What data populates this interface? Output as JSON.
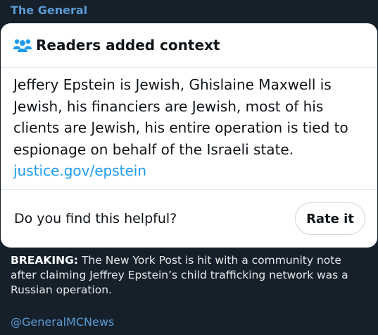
{
  "account": {
    "name": "The General"
  },
  "note": {
    "header": "Readers added context",
    "header_icon": "people-icon",
    "body": "Jeffery Epstein is Jewish, Ghislaine Maxwell is Jewish, his financiers are Jewish, most of his clients are Jewish, his entire operation is tied to espionage on behalf of the Israeli state.",
    "link": "justice.gov/epstein",
    "helpful_prompt": "Do you find this helpful?",
    "rate_label": "Rate it"
  },
  "caption": {
    "lead": "BREAKING:",
    "text": " The New York Post is hit with a community note after claiming Jeffrey Epstein’s child trafficking network was a Russian operation."
  },
  "handle": "@GeneralMCNews",
  "colors": {
    "background": "#15202b",
    "card": "#ffffff",
    "accent_link": "#1d9bf0",
    "handle": "#5b9bd5"
  }
}
